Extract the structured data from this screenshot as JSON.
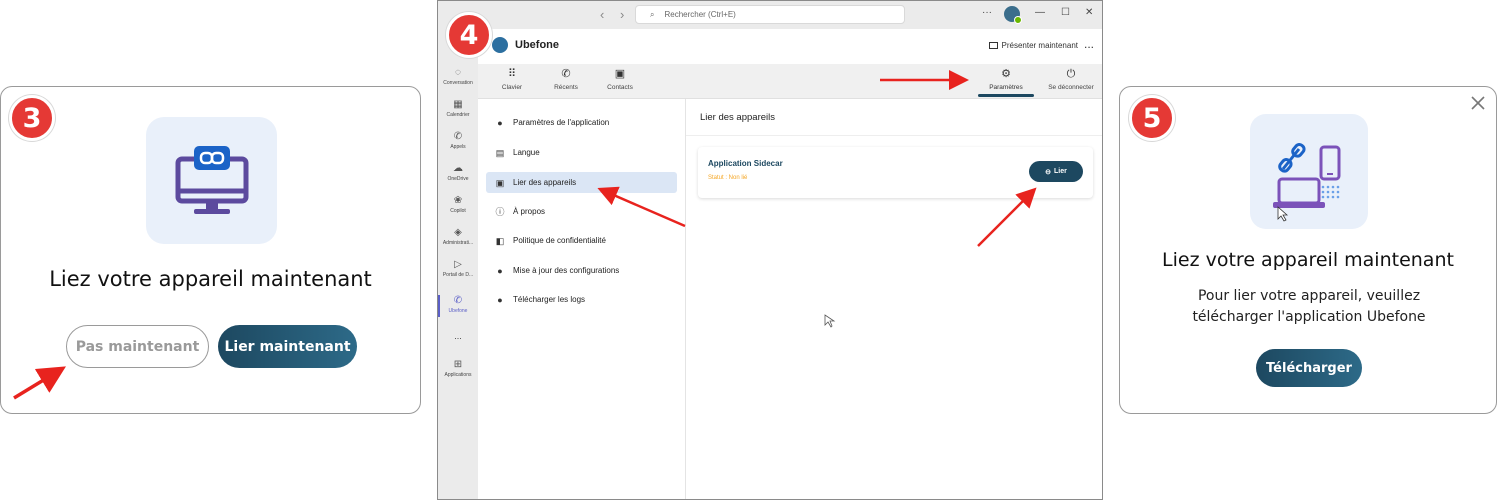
{
  "step3": {
    "badge": "3",
    "title": "Liez votre appareil maintenant",
    "later_label": "Pas maintenant",
    "link_label": "Lier maintenant"
  },
  "step4": {
    "badge": "4",
    "search": {
      "placeholder": "Rechercher (Ctrl+E)"
    },
    "app_name": "Ubefone",
    "present_label": "Présenter maintenant",
    "more_label": "...",
    "rail": [
      {
        "label": "Conversation",
        "icon": "chat-icon"
      },
      {
        "label": "Calendrier",
        "icon": "calendar-icon"
      },
      {
        "label": "Appels",
        "icon": "phone-icon"
      },
      {
        "label": "OneDrive",
        "icon": "cloud-icon"
      },
      {
        "label": "Copilot",
        "icon": "copilot-icon"
      },
      {
        "label": "Administrati...",
        "icon": "admin-icon"
      },
      {
        "label": "Portail de D...",
        "icon": "portal-icon"
      },
      {
        "label": "Ubefone",
        "icon": "ubefone-phone-icon"
      },
      {
        "label": "Applications",
        "icon": "plus-box-icon"
      }
    ],
    "rail_more": "...",
    "toolbar": {
      "clavier": "Clavier",
      "recents": "Récents",
      "contacts": "Contacts",
      "parametres": "Paramètres",
      "deconnecter": "Se déconnecter"
    },
    "menu": [
      {
        "label": "Paramètres de l'application",
        "icon": "user-gear-icon"
      },
      {
        "label": "Langue",
        "icon": "language-icon"
      },
      {
        "label": "Lier des appareils",
        "icon": "device-link-icon"
      },
      {
        "label": "À propos",
        "icon": "info-icon"
      },
      {
        "label": "Politique de confidentialité",
        "icon": "shield-icon"
      },
      {
        "label": "Mise à jour des configurations",
        "icon": "update-icon"
      },
      {
        "label": "Télécharger les logs",
        "icon": "download-icon"
      }
    ],
    "content_title": "Lier des appareils",
    "sidecar": {
      "name": "Application Sidecar",
      "status": "Statut : Non lié",
      "button": "Lier"
    }
  },
  "step5": {
    "badge": "5",
    "title": "Liez votre appareil maintenant",
    "desc_line1": "Pour lier votre appareil, veuillez",
    "desc_line2": "télécharger l'application Ubefone",
    "download_label": "Télécharger"
  },
  "colors": {
    "badge": "#e53935",
    "primary": "#1d4860",
    "arrow": "#e8231e",
    "status": "#f5a623",
    "active_menu": "#dbe6f5"
  }
}
